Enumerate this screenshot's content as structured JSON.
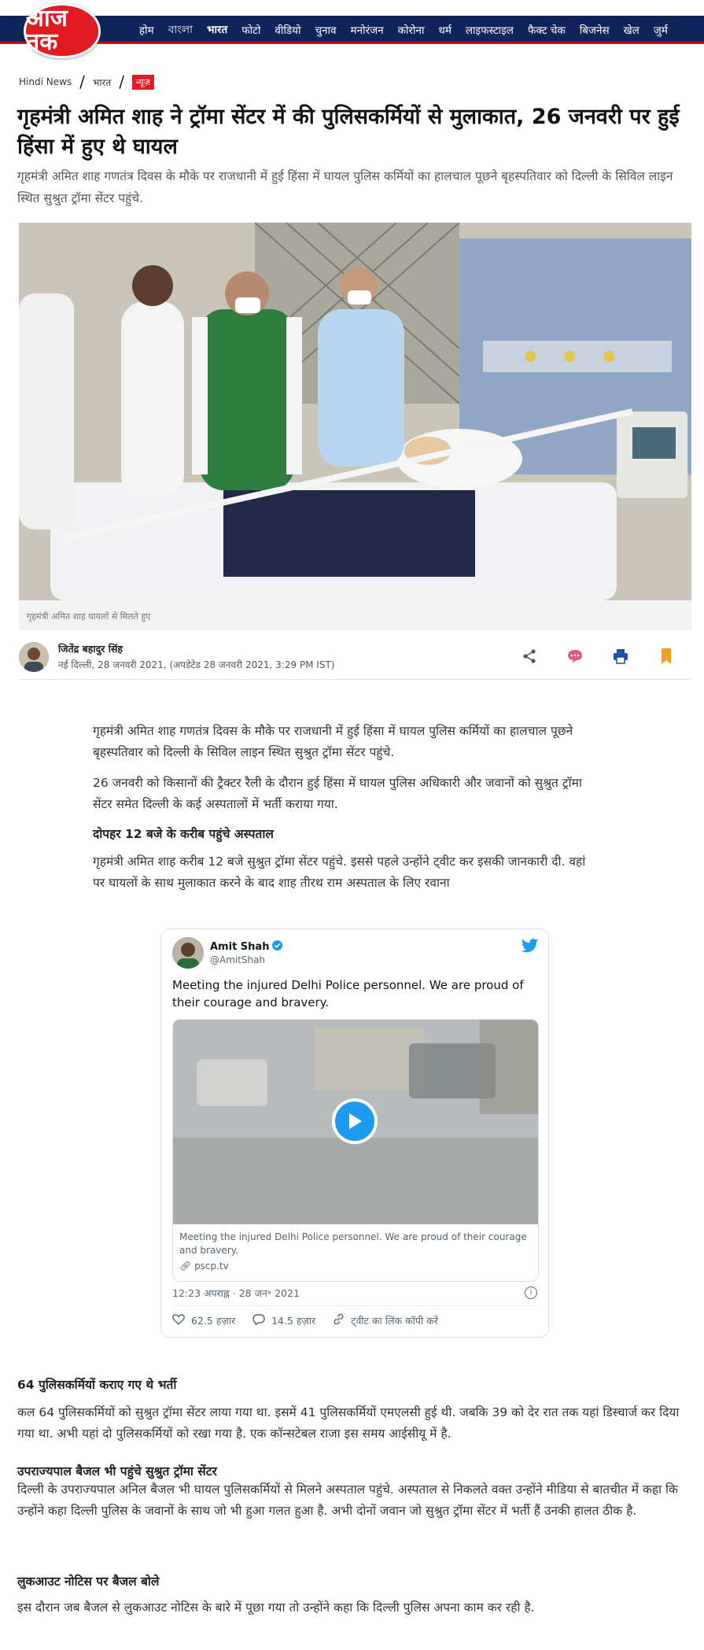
{
  "header": {
    "logo_text": "आज तक",
    "nav": [
      "होम",
      "বাংলা",
      "भारत",
      "फोटो",
      "वीडियो",
      "चुनाव",
      "मनोरंजन",
      "कोरोना",
      "धर्म",
      "लाइफस्टाइल",
      "फैक्ट चेक",
      "बिजनेस",
      "खेल",
      "जुर्म"
    ],
    "active_nav": "भारत",
    "brand_color": "#e21b22",
    "nav_bg": "#10245c"
  },
  "breadcrumb": {
    "home": "Hindi News",
    "section": "भारत",
    "current": "न्यूज़"
  },
  "article": {
    "headline": "गृहमंत्री अमित शाह ने ट्रॉमा सेंटर में की पुलिसकर्मियों से मुलाकात, 26 जनवरी पर हुई हिंसा में हुए थे घायल",
    "standfirst": "गृहमंत्री अमित शाह गणतंत्र दिवस के मौके पर राजधानी में हुई हिंसा में घायल पुलिस कर्मियों का हालचाल पूछने बृहस्पतिवार को दिल्ली के सिविल लाइन स्थित सुश्रुत ट्रॉमा सेंटर पहुंचे.",
    "image_caption": "गृहमंत्री अमित शाह घायलों से मिलते हुए",
    "author": "जितेंद्र बहादुर सिंह",
    "dateline": "नई दिल्ली, 28 जनवरी 2021, (अपडेटेड 28 जनवरी 2021, 3:29 PM IST)",
    "actions": [
      "share-icon",
      "comment-icon",
      "print-icon",
      "bookmark-icon"
    ],
    "p1": "गृहमंत्री अमित शाह गणतंत्र दिवस के मौके पर राजधानी में हुई हिंसा में घायल पुलिस कर्मियों का हालचाल पूछने बृहस्पतिवार को दिल्ली के सिविल लाइन स्थित सुश्रुत ट्रॉमा सेंटर पहुंचे.",
    "p2": "26 जनवरी को किसानों की ट्रैक्टर रैली के दौरान हुई हिंसा में घायल पुलिस अधिकारी और जवानों को सुश्रुत ट्रॉमा सेंटर समेत दिल्ली के कई अस्पतालों में भर्ती कराया गया.",
    "sub1": "दोपहर 12 बजे के करीब पहुंचे अस्पताल",
    "p3": "गृहमंत्री अमित शाह करीब 12 बजे सुश्रुत ट्रॉमा सेंटर पहुंचे. इससे पहले उन्होंने ट्वीट कर इसकी जानकारी दी. वहां पर घायलों के साथ मुलाकात करने के बाद शाह तीरथ राम अस्पताल के लिए रवाना",
    "sub2": "64 पुलिसकर्मियों कराए गए थे भर्ती",
    "p4": "कल 64 पुलिसकर्मियों को सुश्रुत ट्रॉमा सेंटर लाया गया था. इसमें 41 पुलिसकर्मियों एमएलसी हुई थी. जबकि 39 को देर रात तक यहां डिस्चार्ज कर दिया गया था. अभी यहां दो पुलिसकर्मियों को रखा गया है. एक कॉन्सटेबल राजा इस समय आईसीयू में है.",
    "sub3": "उपराज्यपाल बैजल भी पहुंचे सुश्रुत ट्रॉमा सेंटर",
    "p5": "दिल्ली के उपराज्यपाल अनिल बैजल भी घायल पुलिसकर्मियों से मिलने अस्पताल पहुंचे. अस्पताल से निकलते वक्त उन्होंने मीडिया से बातचीत में कहा कि उन्होंने कहा दिल्ली पुलिस के जवानों के साथ जो भी हुआ गलत हुआ है. अभी दोनों जवान जो सुश्रुत ट्रॉमा सेंटर में भर्ती हैं उनकी हालत ठीक है.",
    "sub4": "लुकआउट नोटिस पर बैजल बोले",
    "p6": "इस दौरान जब बैजल से लुकआउट नोटिस के बारे में पूछा गया तो उन्होंने कहा कि दिल्ली पुलिस अपना काम कर रही है."
  },
  "tweet": {
    "name": "Amit Shah",
    "handle": "@AmitShah",
    "text": "Meeting the injured Delhi Police personnel. We are proud of their courage and bravery.",
    "media_text": "Meeting the injured Delhi Police personnel. We are proud of their courage and bravery.",
    "media_link": "pscp.tv",
    "time": "12:23 अपराह्न · 28 जन॰ 2021",
    "likes": "62.5 हज़ार",
    "replies": "14.5 हज़ार",
    "copy_link": "ट्वीट का लिंक कॉपी करें",
    "accent": "#1d9bf0"
  }
}
